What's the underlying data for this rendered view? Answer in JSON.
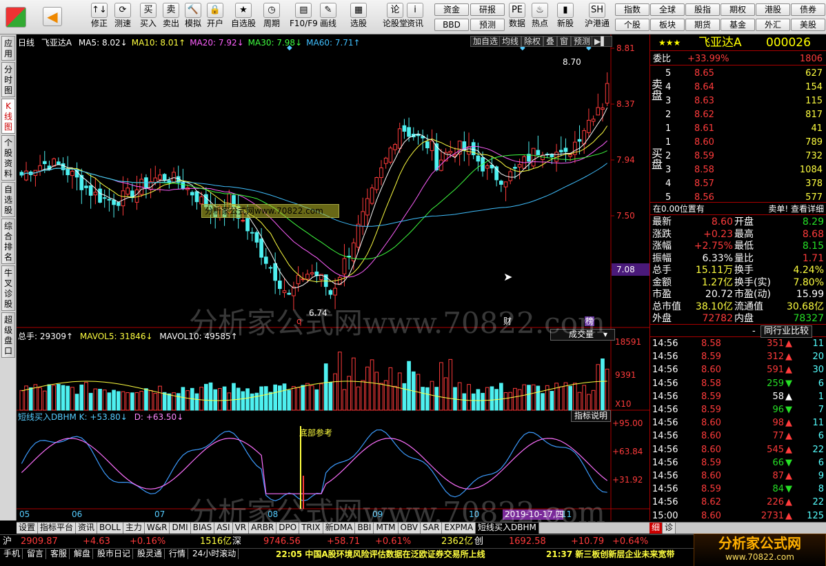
{
  "toolbar": {
    "buttons": [
      {
        "label": "修正",
        "icon": "↑↓"
      },
      {
        "label": "测速",
        "icon": "⟳"
      },
      {
        "label": "买入",
        "icon": "买"
      },
      {
        "label": "卖出",
        "icon": "卖"
      },
      {
        "label": "模拟",
        "icon": "🔨"
      },
      {
        "label": "开户",
        "icon": "🔒"
      },
      {
        "label": "自选股",
        "icon": "★"
      },
      {
        "label": "周期",
        "icon": "◷"
      },
      {
        "label": "F10/F9",
        "icon": "▤"
      },
      {
        "label": "画线",
        "icon": "✎"
      },
      {
        "label": "选股",
        "icon": "▦"
      },
      {
        "label": "论股堂",
        "icon": "论"
      },
      {
        "label": "资讯",
        "icon": "i"
      },
      {
        "label": "数据",
        "icon": "PE"
      },
      {
        "label": "热点",
        "icon": "♨"
      },
      {
        "label": "新股",
        "icon": "▮"
      },
      {
        "label": "沪港通",
        "icon": "SH"
      }
    ],
    "sq_left": [
      "资金",
      "研报",
      "BBD",
      "预测"
    ],
    "sq_right": [
      "指数",
      "全球",
      "股指",
      "期权",
      "港股",
      "债券",
      "个股",
      "板块",
      "期货",
      "基金",
      "外汇",
      "美股"
    ]
  },
  "sidebar": [
    "应用",
    "分时图",
    "K线图",
    "个股资料",
    "自选股",
    "综合排名",
    "牛叉诊股",
    "超级盘口"
  ],
  "chart": {
    "period": "日线",
    "stock_name": "飞亚达A",
    "ma": [
      {
        "label": "MA5: 8.02↓",
        "color": "#ffffff"
      },
      {
        "label": "MA10: 8.01↑",
        "color": "#ffff40"
      },
      {
        "label": "MA20: 7.92↓",
        "color": "#ff60ff"
      },
      {
        "label": "MA30: 7.98↓",
        "color": "#40ff40"
      },
      {
        "label": "MA60: 7.71↑",
        "color": "#40c0ff"
      }
    ],
    "buttons": [
      "加自选",
      "均线",
      "除权",
      "叠",
      "窗",
      "预测"
    ],
    "price_ticks": [
      "8.81",
      "8.37",
      "7.94",
      "7.50",
      "7.08"
    ],
    "high_label": "8.70",
    "low_label": "6.74",
    "marks": [
      "q",
      "财",
      "榜"
    ],
    "banner": "分析家公式网www.70822.com",
    "watermark": "分析家公式网www.70822.com",
    "vol_header": {
      "a": "总手: 29309↑",
      "b": "MAVOL5: 31846↓",
      "c": "MAVOL10: 49585↑"
    },
    "vol_button": "成交量",
    "vol_ticks": [
      "18591",
      "9391",
      "X10"
    ],
    "ind_header": {
      "a": "短线买入DBHM K: +53.80↓",
      "b": "D: +63.50↓"
    },
    "ind_button": "指标说明",
    "ind_ticks": [
      "+95.00",
      "+63.84",
      "+31.92"
    ],
    "ind_annot": "底部参考",
    "date_ticks": [
      "05",
      "06",
      "07",
      "08",
      "09",
      "10",
      "11"
    ],
    "date_cursor": "2019-10-17,四"
  },
  "tabs": [
    "设置",
    "指标平台",
    "资讯",
    "BOLL",
    "主力",
    "W&R",
    "DMI",
    "BIAS",
    "ASI",
    "VR",
    "ARBR",
    "DPO",
    "TRIX",
    "新DMA",
    "BBI",
    "MTM",
    "OBV",
    "SAR",
    "EXPMA",
    "短线买入DBHM"
  ],
  "quote": {
    "stars": "★★★",
    "name": "飞亚达A",
    "code": "000026",
    "weibi": {
      "label": "委比",
      "value": "+33.99%",
      "diff": "1806"
    },
    "sell_label": "卖盘",
    "buy_label": "买盘",
    "sell": [
      {
        "n": "5",
        "p": "8.65",
        "v": "627"
      },
      {
        "n": "4",
        "p": "8.64",
        "v": "154"
      },
      {
        "n": "3",
        "p": "8.63",
        "v": "115"
      },
      {
        "n": "2",
        "p": "8.62",
        "v": "817"
      },
      {
        "n": "1",
        "p": "8.61",
        "v": "41"
      }
    ],
    "buy": [
      {
        "n": "1",
        "p": "8.60",
        "v": "789"
      },
      {
        "n": "2",
        "p": "8.59",
        "v": "732"
      },
      {
        "n": "3",
        "p": "8.58",
        "v": "1084"
      },
      {
        "n": "4",
        "p": "8.57",
        "v": "378"
      },
      {
        "n": "5",
        "p": "8.56",
        "v": "577"
      }
    ],
    "pos_text": "在0.00位置有",
    "pos_right": "卖单! 查看详细",
    "stats": [
      {
        "k1": "最新",
        "v1": "8.60",
        "c1": "red",
        "k2": "开盘",
        "v2": "8.29",
        "c2": "green"
      },
      {
        "k1": "涨跌",
        "v1": "+0.23",
        "c1": "red",
        "k2": "最高",
        "v2": "8.68",
        "c2": "red"
      },
      {
        "k1": "涨幅",
        "v1": "+2.75%",
        "c1": "red",
        "k2": "最低",
        "v2": "8.15",
        "c2": "green"
      },
      {
        "k1": "振幅",
        "v1": "6.33%",
        "c1": "white",
        "k2": "量比",
        "v2": "1.71",
        "c2": "red"
      },
      {
        "k1": "总手",
        "v1": "15.11万",
        "c1": "yellow",
        "k2": "换手",
        "v2": "4.24%",
        "c2": "yellow"
      },
      {
        "k1": "金额",
        "v1": "1.27亿",
        "c1": "yellow",
        "k2": "换手(实)",
        "v2": "7.80%",
        "c2": "yellow"
      },
      {
        "k1": "市盈",
        "v1": "20.72",
        "c1": "white",
        "k2": "市盈(动)",
        "v2": "15.99",
        "c2": "white"
      },
      {
        "k1": "总市值",
        "v1": "38.10亿",
        "c1": "yellow",
        "k2": "流通值",
        "v2": "30.68亿",
        "c2": "yellow"
      },
      {
        "k1": "外盘",
        "v1": "72782",
        "c1": "red",
        "k2": "内盘",
        "v2": "78327",
        "c2": "green"
      }
    ],
    "ticks_header": {
      "dash": "-",
      "compare": "同行业比较"
    },
    "ticks": [
      {
        "t": "14:56",
        "p": "8.58",
        "v": "351",
        "d": "up",
        "n": "11"
      },
      {
        "t": "14:56",
        "p": "8.59",
        "v": "312",
        "d": "up",
        "n": "20"
      },
      {
        "t": "14:56",
        "p": "8.60",
        "v": "591",
        "d": "up",
        "n": "30"
      },
      {
        "t": "14:56",
        "p": "8.58",
        "v": "259",
        "d": "down",
        "n": "6"
      },
      {
        "t": "14:56",
        "p": "8.59",
        "v": "58",
        "d": "neutral",
        "n": "1"
      },
      {
        "t": "14:56",
        "p": "8.59",
        "v": "96",
        "d": "down",
        "n": "7"
      },
      {
        "t": "14:56",
        "p": "8.60",
        "v": "98",
        "d": "up",
        "n": "11"
      },
      {
        "t": "14:56",
        "p": "8.60",
        "v": "77",
        "d": "up",
        "n": "6"
      },
      {
        "t": "14:56",
        "p": "8.60",
        "v": "545",
        "d": "up",
        "n": "22"
      },
      {
        "t": "14:56",
        "p": "8.59",
        "v": "66",
        "d": "down",
        "n": "6"
      },
      {
        "t": "14:56",
        "p": "8.60",
        "v": "87",
        "d": "up",
        "n": "9"
      },
      {
        "t": "14:56",
        "p": "8.59",
        "v": "84",
        "d": "down",
        "n": "8"
      },
      {
        "t": "14:56",
        "p": "8.62",
        "v": "226",
        "d": "up",
        "n": "22"
      },
      {
        "t": "15:00",
        "p": "8.60",
        "v": "2731",
        "d": "up",
        "n": "125"
      }
    ],
    "bottom_tabs": [
      "细",
      "诊"
    ]
  },
  "indexbar": {
    "sh_label": "沪",
    "sh": "2909.87",
    "sh_chg": "+4.63",
    "sh_pct": "+0.16%",
    "sh_amt": "1516亿",
    "sz_label": "深",
    "sz": "9746.56",
    "sz_chg": "+58.71",
    "sz_pct": "+0.61%",
    "sz_amt": "2362亿",
    "cy_label": "创",
    "cy": "1692.58",
    "cy_chg": "+10.79",
    "cy_pct": "+0.64%"
  },
  "statusbar": {
    "items": [
      "手机",
      "留言",
      "客服",
      "解盘",
      "股市日记",
      "股灵通",
      "行情",
      "24小时滚动"
    ],
    "news1": "22:05 中国A股环境风险评估数据在泛欧证券交易所上线",
    "news2": "21:37 新三板创新层企业未来宽带",
    "logo": "分析家公式网",
    "logo_url": "www.70822.com"
  }
}
